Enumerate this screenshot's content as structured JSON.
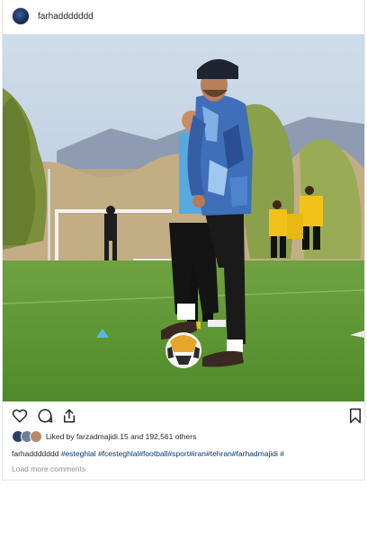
{
  "post": {
    "username": "farhaddddddd",
    "avatar_icon": "user-avatar",
    "liked_by_prefix": "Liked by",
    "liked_by_user": "farzadmajidi.15",
    "liked_by_suffix": "and 192,561 others",
    "caption_user": "farhaddddddd",
    "caption_text": "#esteghlal #fcesteghlal#football#sport#iran#tehran#farhadmajidi #",
    "load_more": "Load more comments"
  },
  "icons": {
    "like": "heart-icon",
    "comment": "comment-icon",
    "share": "share-icon",
    "save": "bookmark-icon"
  },
  "colors": {
    "hashtag": "#00376b",
    "muted": "#8e8e8e",
    "text": "#262626"
  }
}
